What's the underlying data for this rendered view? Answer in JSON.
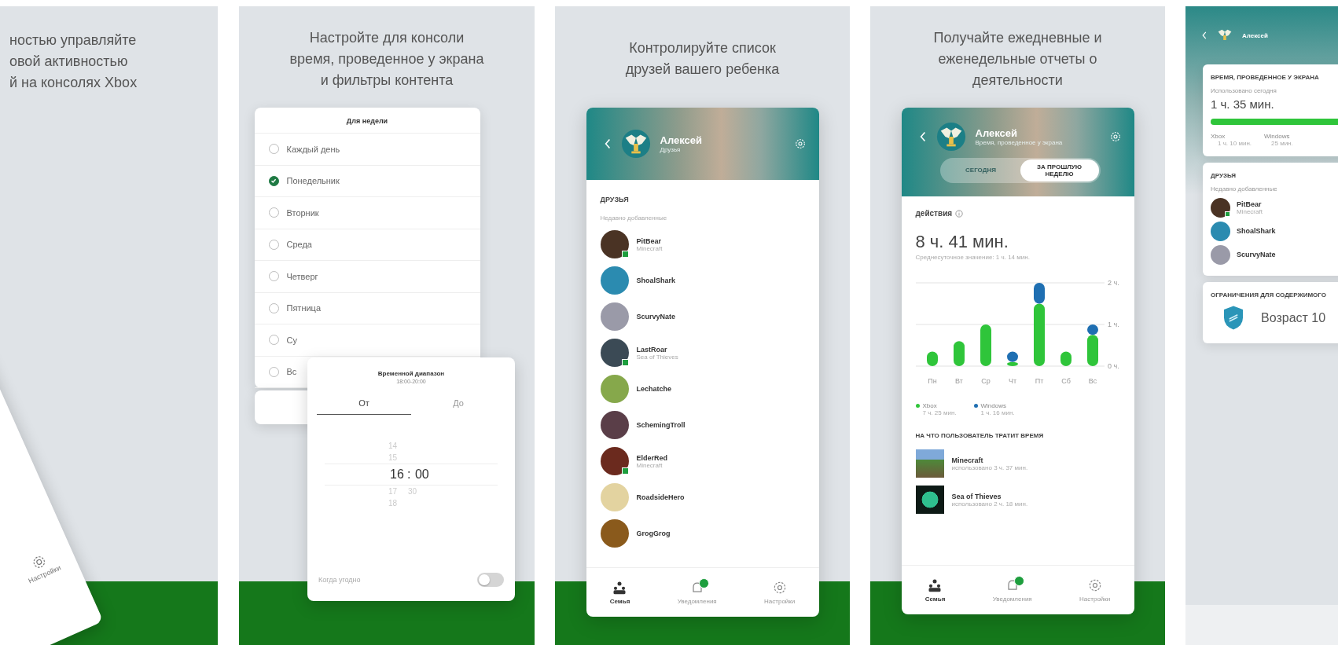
{
  "promo_1": {
    "caption": [
      "ностью управляйте",
      "овой активностью",
      "й на консолях Xbox"
    ],
    "phone": {
      "nav_item": "Настройки"
    }
  },
  "promo_2": {
    "caption": [
      "Настройте для консоли",
      "время, проведенное у экрана",
      "и фильтры контента"
    ],
    "schedule": {
      "title": "Для недели",
      "options": [
        {
          "label": "Каждый день",
          "selected": false
        },
        {
          "label": "Понедельник",
          "selected": true
        },
        {
          "label": "Вторник",
          "selected": false
        },
        {
          "label": "Среда",
          "selected": false
        },
        {
          "label": "Четверг",
          "selected": false
        },
        {
          "label": "Пятница",
          "selected": false
        },
        {
          "label": "Су",
          "selected": false
        },
        {
          "label": "Вс",
          "selected": false
        }
      ]
    },
    "time_range": {
      "title": "Временной диапазон",
      "subtitle": "18:00-20:00",
      "tabs": [
        {
          "label": "От",
          "selected": true
        },
        {
          "label": "До",
          "selected": false
        }
      ],
      "separator": ":",
      "picker": [
        {
          "hour": "14",
          "selected": false
        },
        {
          "hour": "15",
          "selected": false
        },
        {
          "hour": "16",
          "minute": "00",
          "selected": true
        },
        {
          "hour": "17",
          "minute": "30",
          "selected": false
        },
        {
          "hour": "18",
          "selected": false
        }
      ],
      "toggle": {
        "label": "Когда угодно",
        "on": false
      }
    }
  },
  "promo_3": {
    "caption": [
      "Контролируйте список",
      "друзей вашего ребенка"
    ],
    "profile": {
      "name": "Алексей",
      "subtitle": "Друзья"
    },
    "section": "ДРУЗЬЯ",
    "subsection": "Недавно добавленные",
    "friends": [
      {
        "name": "PitBear",
        "game": "Minecraft",
        "online": true
      },
      {
        "name": "ShoalShark",
        "online": false
      },
      {
        "name": "ScurvyNate",
        "online": false
      },
      {
        "name": "LastRoar",
        "game": "Sea of Thieves",
        "online": true
      },
      {
        "name": "Lechatche",
        "online": false
      },
      {
        "name": "SchemingTroll",
        "online": false
      },
      {
        "name": "ElderRed",
        "game": "Minecraft",
        "online": true
      },
      {
        "name": "RoadsideHero",
        "online": false
      },
      {
        "name": "GrogGrog",
        "online": false
      }
    ],
    "nav": [
      {
        "kind": "family",
        "label": "Семья",
        "selected": true
      },
      {
        "kind": "bell",
        "label": "Уведомления",
        "selected": false,
        "badge": true
      },
      {
        "kind": "gear",
        "label": "Настройки",
        "selected": false
      }
    ]
  },
  "promo_4": {
    "caption": [
      "Получайте ежедневные и",
      "еженедельные отчеты о",
      "деятельности"
    ],
    "profile": {
      "name": "Алексей",
      "subtitle": "Время, проведенное у экрана"
    },
    "segments": [
      {
        "label": "СЕГОДНЯ",
        "selected": false
      },
      {
        "label": "ЗА ПРОШЛУЮ НЕДЕЛЮ",
        "selected": true
      }
    ],
    "activity": {
      "heading": "действия",
      "total": "8 ч. 41 мин.",
      "average": "Среднесуточное значение: 1 ч. 14 мин."
    },
    "chart_data": {
      "type": "bar",
      "stacked": true,
      "categories": [
        "Пн",
        "Вт",
        "Ср",
        "Чт",
        "Пт",
        "Сб",
        "Вс"
      ],
      "ylim": [
        0,
        2
      ],
      "yticks": [
        {
          "value": 0,
          "label": "0 ч."
        },
        {
          "value": 1,
          "label": "1 ч."
        },
        {
          "value": 2,
          "label": "2 ч."
        }
      ],
      "series": [
        {
          "name": "Xbox",
          "color": "#2fc53a",
          "values": [
            0.35,
            0.6,
            1.0,
            0.1,
            1.5,
            0.35,
            0.75
          ]
        },
        {
          "name": "Windows",
          "color": "#1f6fb2",
          "values": [
            0,
            0,
            0,
            0.25,
            0.5,
            0,
            0.25
          ]
        }
      ]
    },
    "legend_times": [
      "7 ч. 25 мин.",
      "1 ч. 16 мин."
    ],
    "apps_heading": "НА ЧТО ПОЛЬЗОВАТЕЛЬ ТРАТИТ ВРЕМЯ",
    "apps": [
      {
        "name": "Minecraft",
        "usage": "использовано 3 ч. 37 мин."
      },
      {
        "name": "Sea of Thieves",
        "usage": "использовано 2 ч. 18 мин."
      }
    ],
    "nav": [
      {
        "kind": "family",
        "label": "Семья",
        "selected": true
      },
      {
        "kind": "bell",
        "label": "Уведомления",
        "selected": false,
        "badge": true
      },
      {
        "kind": "gear",
        "label": "Настройки",
        "selected": false
      }
    ]
  },
  "promo_5": {
    "profile": {
      "name": "Алексей"
    },
    "screen_time": {
      "heading": "ВРЕМЯ, ПРОВЕДЕННОЕ У ЭКРАНА",
      "label": "Использовано сегодня",
      "value": "1 ч. 35 мин.",
      "level": 0.85,
      "legend": [
        {
          "name": "Xbox",
          "time": "1 ч. 10 мин."
        },
        {
          "name": "Windows",
          "time": "25 мин."
        }
      ]
    },
    "friends": {
      "heading": "ДРУЗЬЯ",
      "subheading": "Недавно добавленные",
      "items": [
        {
          "name": "PitBear",
          "game": "Minecraft",
          "online": true
        },
        {
          "name": "ShoalShark",
          "online": false
        },
        {
          "name": "ScurvyNate",
          "online": false
        }
      ]
    },
    "content": {
      "heading": "ОГРАНИЧЕНИЯ ДЛЯ СОДЕРЖИМОГО",
      "value": "Возраст 10"
    }
  }
}
